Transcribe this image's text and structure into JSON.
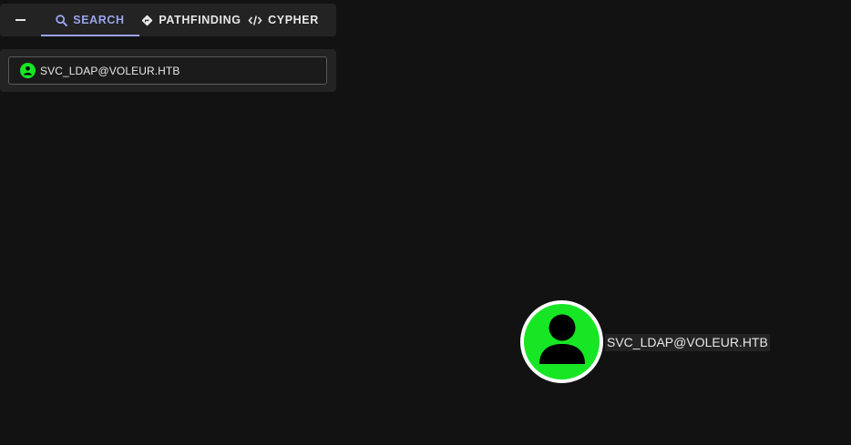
{
  "tabs": {
    "search": "SEARCH",
    "pathfinding": "PATHFINDING",
    "cypher": "CYPHER"
  },
  "search_panel": {
    "selected_value": "SVC_LDAP@VOLEUR.HTB"
  },
  "graph": {
    "node_label": "SVC_LDAP@VOLEUR.HTB",
    "node_color": "#17e625",
    "node_icon": "user-icon"
  },
  "colors": {
    "accent": "#9aa4ee",
    "background": "#121212",
    "panel": "#232323"
  }
}
